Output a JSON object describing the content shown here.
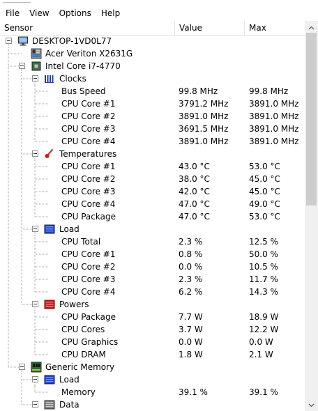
{
  "menu": [
    "File",
    "View",
    "Options",
    "Help"
  ],
  "columns": {
    "sensor": "Sensor",
    "value": "Value",
    "max": "Max"
  },
  "rows": [
    {
      "level": 0,
      "toggle": true,
      "icon": "computer-icon",
      "label": "DESKTOP-1VD0L77",
      "value": "",
      "max": ""
    },
    {
      "level": 1,
      "toggle": false,
      "icon": "motherboard-icon",
      "label": "Acer Veriton X2631G",
      "value": "",
      "max": ""
    },
    {
      "level": 1,
      "toggle": true,
      "icon": "cpu-chip-icon",
      "label": "Intel Core i7-4770",
      "value": "",
      "max": ""
    },
    {
      "level": 2,
      "toggle": true,
      "icon": "clock-bars-icon",
      "label": "Clocks",
      "value": "",
      "max": ""
    },
    {
      "level": 3,
      "toggle": false,
      "icon": "",
      "label": "Bus Speed",
      "value": "99.8 MHz",
      "max": "99.8 MHz"
    },
    {
      "level": 3,
      "toggle": false,
      "icon": "",
      "label": "CPU Core #1",
      "value": "3791.2 MHz",
      "max": "3891.0 MHz"
    },
    {
      "level": 3,
      "toggle": false,
      "icon": "",
      "label": "CPU Core #2",
      "value": "3891.0 MHz",
      "max": "3891.0 MHz"
    },
    {
      "level": 3,
      "toggle": false,
      "icon": "",
      "label": "CPU Core #3",
      "value": "3691.5 MHz",
      "max": "3891.0 MHz"
    },
    {
      "level": 3,
      "toggle": false,
      "icon": "",
      "label": "CPU Core #4",
      "value": "3891.0 MHz",
      "max": "3891.0 MHz"
    },
    {
      "level": 2,
      "toggle": true,
      "icon": "thermometer-icon",
      "label": "Temperatures",
      "value": "",
      "max": ""
    },
    {
      "level": 3,
      "toggle": false,
      "icon": "",
      "label": "CPU Core #1",
      "value": "43.0 °C",
      "max": "53.0 °C"
    },
    {
      "level": 3,
      "toggle": false,
      "icon": "",
      "label": "CPU Core #2",
      "value": "38.0 °C",
      "max": "45.0 °C"
    },
    {
      "level": 3,
      "toggle": false,
      "icon": "",
      "label": "CPU Core #3",
      "value": "42.0 °C",
      "max": "45.0 °C"
    },
    {
      "level": 3,
      "toggle": false,
      "icon": "",
      "label": "CPU Core #4",
      "value": "47.0 °C",
      "max": "49.0 °C"
    },
    {
      "level": 3,
      "toggle": false,
      "icon": "",
      "label": "CPU Package",
      "value": "47.0 °C",
      "max": "53.0 °C"
    },
    {
      "level": 2,
      "toggle": true,
      "icon": "load-gauge-icon",
      "label": "Load",
      "value": "",
      "max": ""
    },
    {
      "level": 3,
      "toggle": false,
      "icon": "",
      "label": "CPU Total",
      "value": "2.3 %",
      "max": "12.5 %"
    },
    {
      "level": 3,
      "toggle": false,
      "icon": "",
      "label": "CPU Core #1",
      "value": "0.8 %",
      "max": "50.0 %"
    },
    {
      "level": 3,
      "toggle": false,
      "icon": "",
      "label": "CPU Core #2",
      "value": "0.0 %",
      "max": "10.5 %"
    },
    {
      "level": 3,
      "toggle": false,
      "icon": "",
      "label": "CPU Core #3",
      "value": "2.3 %",
      "max": "11.7 %"
    },
    {
      "level": 3,
      "toggle": false,
      "icon": "",
      "label": "CPU Core #4",
      "value": "6.2 %",
      "max": "14.3 %"
    },
    {
      "level": 2,
      "toggle": true,
      "icon": "power-gauge-icon",
      "label": "Powers",
      "value": "",
      "max": ""
    },
    {
      "level": 3,
      "toggle": false,
      "icon": "",
      "label": "CPU Package",
      "value": "7.7 W",
      "max": "18.9 W"
    },
    {
      "level": 3,
      "toggle": false,
      "icon": "",
      "label": "CPU Cores",
      "value": "3.7 W",
      "max": "12.2 W"
    },
    {
      "level": 3,
      "toggle": false,
      "icon": "",
      "label": "CPU Graphics",
      "value": "0.0 W",
      "max": "0.0 W"
    },
    {
      "level": 3,
      "toggle": false,
      "icon": "",
      "label": "CPU DRAM",
      "value": "1.8 W",
      "max": "2.1 W"
    },
    {
      "level": 1,
      "toggle": true,
      "icon": "memory-module-icon",
      "label": "Generic Memory",
      "value": "",
      "max": ""
    },
    {
      "level": 2,
      "toggle": true,
      "icon": "load-gauge-icon",
      "label": "Load",
      "value": "",
      "max": ""
    },
    {
      "level": 3,
      "toggle": false,
      "icon": "",
      "label": "Memory",
      "value": "39.1 %",
      "max": "39.1 %"
    },
    {
      "level": 2,
      "toggle": true,
      "icon": "data-disk-icon",
      "label": "Data",
      "value": "",
      "max": ""
    }
  ]
}
